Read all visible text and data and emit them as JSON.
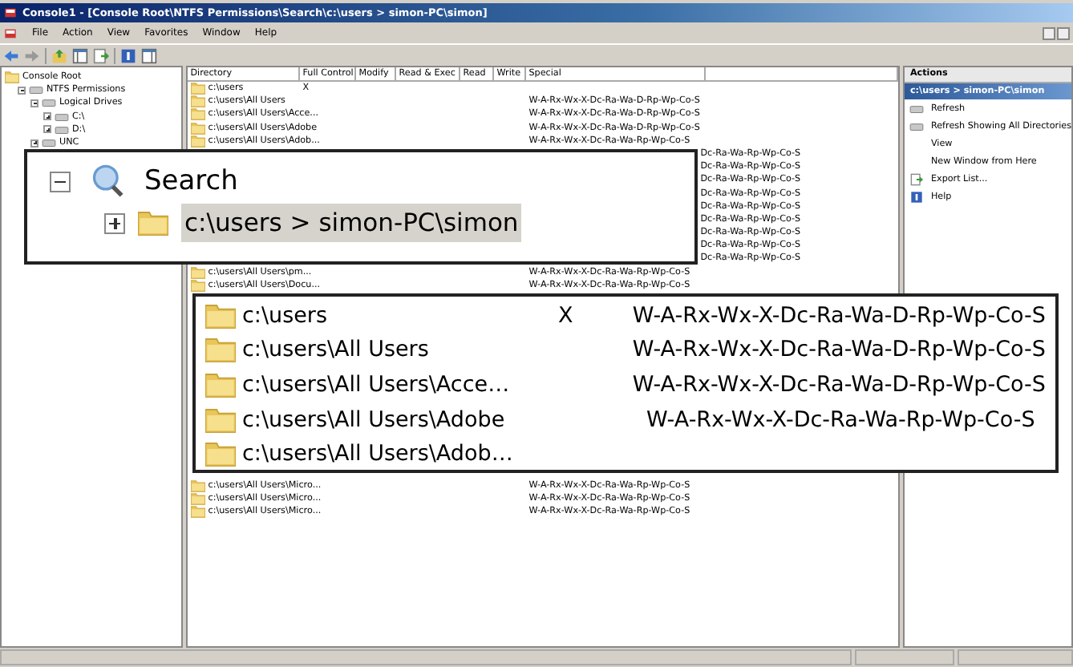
{
  "window": {
    "title": "Console1 - [Console Root\\NTFS Permissions\\Search\\c:\\users > simon-PC\\simon]"
  },
  "menu": [
    "File",
    "Action",
    "View",
    "Favorites",
    "Window",
    "Help"
  ],
  "tree": [
    {
      "label": "Console Root",
      "children": [
        {
          "label": "NTFS Permissions",
          "expanded": true,
          "children": [
            {
              "label": "Logical Drives",
              "expanded": true,
              "children": [
                {
                  "label": "C:\\",
                  "expanded": false
                },
                {
                  "label": "D:\\",
                  "expanded": false
                }
              ]
            },
            {
              "label": "UNC",
              "expanded": false
            }
          ]
        }
      ]
    }
  ],
  "table": {
    "columns": [
      "Directory",
      "Full Control",
      "Modify",
      "Read & Exec",
      "Read",
      "Write",
      "Special"
    ],
    "rows": [
      {
        "kind": "row",
        "directory": "c:\\users",
        "full_control": "X"
      },
      {
        "kind": "row",
        "directory": "c:\\users\\All Users",
        "special": "W-A-Rx-Wx-X-Dc-Ra-Wa-D-Rp-Wp-Co-S"
      },
      {
        "kind": "row",
        "directory": "c:\\users\\All Users\\Acce...",
        "special": "W-A-Rx-Wx-X-Dc-Ra-Wa-D-Rp-Wp-Co-S"
      },
      {
        "kind": "row",
        "directory": "c:\\users\\All Users\\Adobe",
        "special": "W-A-Rx-Wx-X-Dc-Ra-Wa-D-Rp-Wp-Co-S"
      },
      {
        "kind": "row",
        "directory": "c:\\users\\All Users\\Adob...",
        "special": "W-A-Rx-Wx-X-Dc-Ra-Wa-Rp-Wp-Co-S"
      },
      {
        "kind": "covered",
        "special": "Dc-Ra-Wa-Rp-Wp-Co-S"
      },
      {
        "kind": "covered",
        "special": "Dc-Ra-Wa-Rp-Wp-Co-S"
      },
      {
        "kind": "covered",
        "special": "Dc-Ra-Wa-Rp-Wp-Co-S"
      },
      {
        "kind": "covered",
        "special": "Dc-Ra-Wa-Rp-Wp-Co-S"
      },
      {
        "kind": "covered",
        "special": "Dc-Ra-Wa-Rp-Wp-Co-S"
      },
      {
        "kind": "covered",
        "special": "Dc-Ra-Wa-Rp-Wp-Co-S"
      },
      {
        "kind": "covered",
        "special": "Dc-Ra-Wa-Rp-Wp-Co-S"
      },
      {
        "kind": "covered",
        "special": "Dc-Ra-Wa-Rp-Wp-Co-S"
      },
      {
        "kind": "covered",
        "special": "Dc-Ra-Wa-Rp-Wp-Co-S"
      },
      {
        "kind": "row",
        "directory": "c:\\users\\All Users\\pm...",
        "special": "W-A-Rx-Wx-X-Dc-Ra-Wa-Rp-Wp-Co-S"
      },
      {
        "kind": "row",
        "directory": "c:\\users\\All Users\\Docu...",
        "special": "W-A-Rx-Wx-X-Dc-Ra-Wa-Rp-Wp-Co-S"
      }
    ],
    "more_rows": [
      {
        "kind": "row",
        "directory": "c:\\users\\All Users\\Micro...",
        "special": "W-A-Rx-Wx-X-Dc-Ra-Wa-Rp-Wp-Co-S"
      },
      {
        "kind": "row",
        "directory": "c:\\users\\All Users\\Micro...",
        "special": "W-A-Rx-Wx-X-Dc-Ra-Wa-Rp-Wp-Co-S"
      },
      {
        "kind": "row",
        "directory": "c:\\users\\All Users\\Micro...",
        "special": "W-A-Rx-Wx-X-Dc-Ra-Wa-Rp-Wp-Co-S"
      }
    ]
  },
  "actions": {
    "title": "Actions",
    "section": "c:\\users > simon-PC\\simon",
    "items": [
      {
        "label": "Refresh"
      },
      {
        "label": "Refresh Showing All Directories"
      },
      {
        "label": "View"
      },
      {
        "label": "New Window from Here"
      },
      {
        "label": "Export List..."
      },
      {
        "label": "Help"
      }
    ]
  },
  "callout_tree": {
    "label": "Search",
    "expanded": true,
    "child": {
      "label": "c:\\users > simon-PC\\simon",
      "expanded": false,
      "selected": true
    }
  },
  "callout_rows": [
    {
      "directory": "c:\\users",
      "full_control": "X",
      "special": "W-A-Rx-Wx-X-Dc-Ra-Wa-D-Rp-Wp-Co-S"
    },
    {
      "directory": "c:\\users\\All Users",
      "special": "W-A-Rx-Wx-X-Dc-Ra-Wa-D-Rp-Wp-Co-S"
    },
    {
      "directory": "c:\\users\\All Users\\Acce…",
      "special": "W-A-Rx-Wx-X-Dc-Ra-Wa-D-Rp-Wp-Co-S"
    },
    {
      "directory": "c:\\users\\All Users\\Adobe",
      "special": "W-A-Rx-Wx-X-Dc-Ra-Wa-Rp-Wp-Co-S"
    },
    {
      "directory": "c:\\users\\All Users\\Adob…"
    }
  ]
}
